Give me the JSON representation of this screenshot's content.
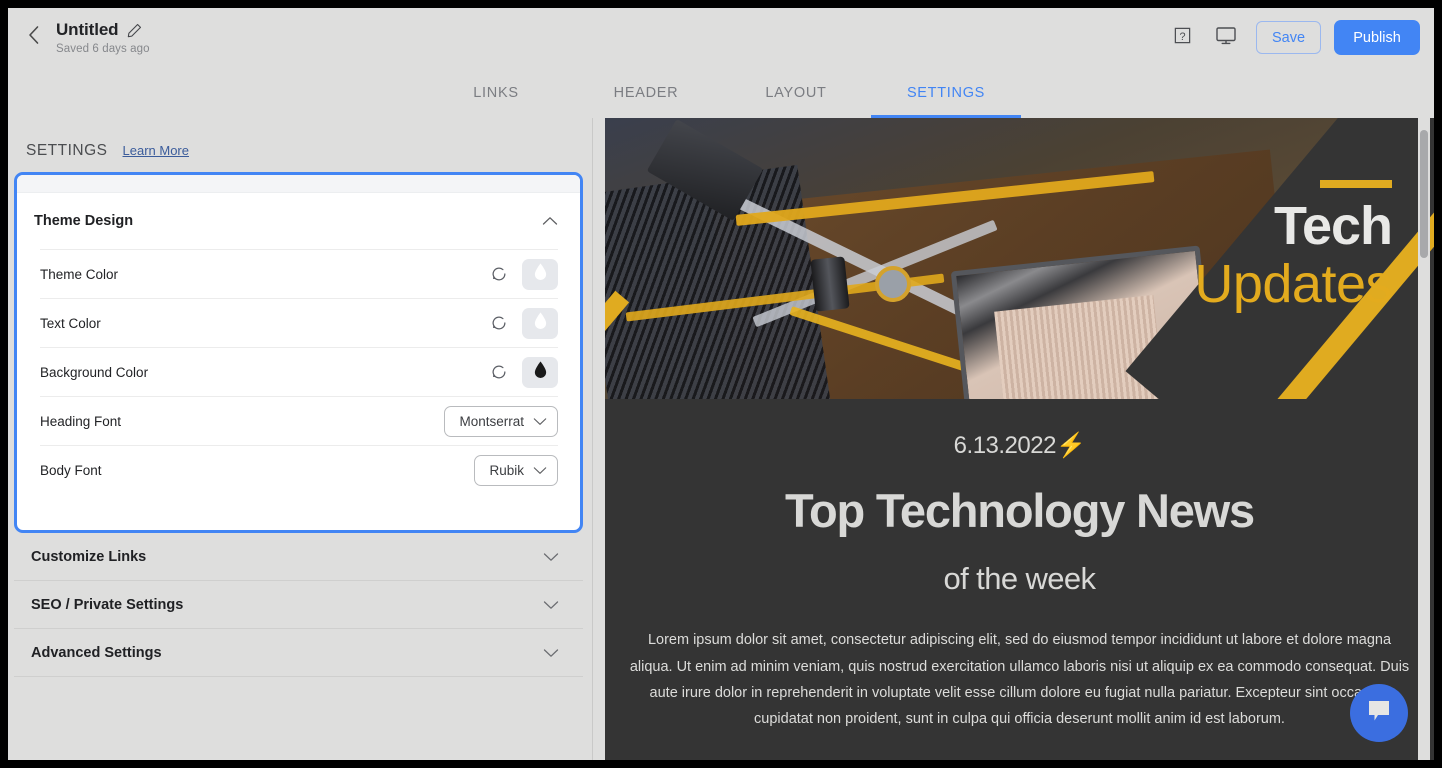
{
  "topbar": {
    "back_icon": "chevron-left-icon",
    "doc_title": "Untitled",
    "edit_icon": "pencil-icon",
    "saved_note": "Saved 6 days ago",
    "help_icon": "question-mark-box-icon",
    "preview_icon": "monitor-icon",
    "save_label": "Save",
    "publish_label": "Publish",
    "accent_color": "#4285f4"
  },
  "tabs": [
    {
      "label": "LINKS",
      "active": false
    },
    {
      "label": "HEADER",
      "active": false
    },
    {
      "label": "LAYOUT",
      "active": false
    },
    {
      "label": "SETTINGS",
      "active": true
    }
  ],
  "settings": {
    "header_label": "SETTINGS",
    "learn_more_label": "Learn More",
    "theme_section": {
      "title": "Theme Design",
      "expanded": true,
      "collapse_icon": "chevron-up-icon",
      "rows": [
        {
          "label": "Theme Color",
          "control": "color",
          "reset_icon": "reset-circular-arrow-icon",
          "swatch_icon": "droplet-icon",
          "swatch_color": "#ffffff",
          "swatch_bg": "#e6e8ec"
        },
        {
          "label": "Text Color",
          "control": "color",
          "reset_icon": "reset-circular-arrow-icon",
          "swatch_icon": "droplet-icon",
          "swatch_color": "#ffffff",
          "swatch_bg": "#e6e8ec"
        },
        {
          "label": "Background Color",
          "control": "color",
          "reset_icon": "reset-circular-arrow-icon",
          "swatch_icon": "droplet-icon",
          "swatch_color": "#1a1a1a",
          "swatch_bg": "#e6e8ec"
        },
        {
          "label": "Heading Font",
          "control": "select",
          "value": "Montserrat",
          "caret_icon": "chevron-down-icon"
        },
        {
          "label": "Body Font",
          "control": "select",
          "value": "Rubik",
          "caret_icon": "chevron-down-icon"
        }
      ]
    },
    "collapsed_sections": [
      {
        "title": "Customize Links",
        "caret_icon": "chevron-down-icon"
      },
      {
        "title": "SEO / Private Settings",
        "caret_icon": "chevron-down-icon"
      },
      {
        "title": "Advanced Settings",
        "caret_icon": "chevron-down-icon"
      }
    ]
  },
  "preview": {
    "hero": {
      "line_accent_color": "#e0ab20",
      "title_primary": "Tech",
      "title_secondary": "Updates",
      "image_alt": "computer-motherboard-photo"
    },
    "date": "6.13.2022⚡",
    "heading": "Top Technology News",
    "subheading": "of the week",
    "body": "Lorem ipsum dolor sit amet, consectetur adipiscing elit, sed do eiusmod tempor incididunt ut labore et dolore magna aliqua. Ut enim ad minim veniam, quis nostrud exercitation ullamco laboris nisi ut aliquip ex ea commodo consequat. Duis aute irure dolor in reprehenderit in voluptate velit esse cillum dolore eu fugiat nulla pariatur. Excepteur sint occaecat cupidatat non proident, sunt in culpa qui officia deserunt mollit anim id est laborum.",
    "background_color": "#343434",
    "text_color": "#d8d8d6",
    "chat_icon": "chat-bubble-icon",
    "chat_color": "#3b6ee0"
  }
}
